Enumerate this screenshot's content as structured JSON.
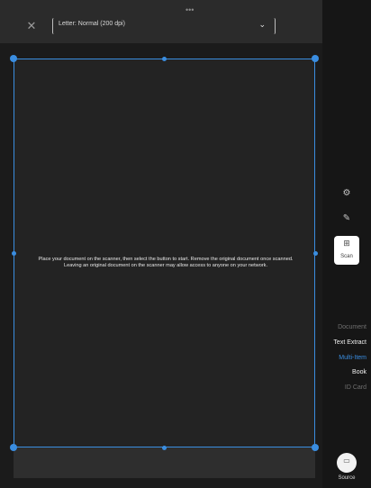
{
  "topbar": {
    "grabber": "•••",
    "close_icon": "✕",
    "paper_size": {
      "selected_value": "Letter: Normal (200 dpi)",
      "chevron_icon": "⌄"
    }
  },
  "preview": {
    "instructions": "Place your document on the scanner, then select the button to start. Remove the original document once scanned. Leaving an original document on the scanner may allow access to anyone on your network."
  },
  "sidebar": {
    "icons": {
      "settings_icon": "⚙",
      "edit_icon": "✎"
    },
    "scan_button": {
      "icon": "⊞",
      "label": "Scan"
    },
    "modes": [
      {
        "label": "Document",
        "state": "dim"
      },
      {
        "label": "Text Extract",
        "state": "white"
      },
      {
        "label": "Multi-Item",
        "state": "active"
      },
      {
        "label": "Book",
        "state": "white"
      },
      {
        "label": "ID Card",
        "state": "dim"
      }
    ],
    "source": {
      "icon": "▭",
      "label": "Source"
    }
  },
  "colors": {
    "accent": "#3a8de0",
    "background": "#1b1b1b",
    "sidebar": "#161616"
  }
}
